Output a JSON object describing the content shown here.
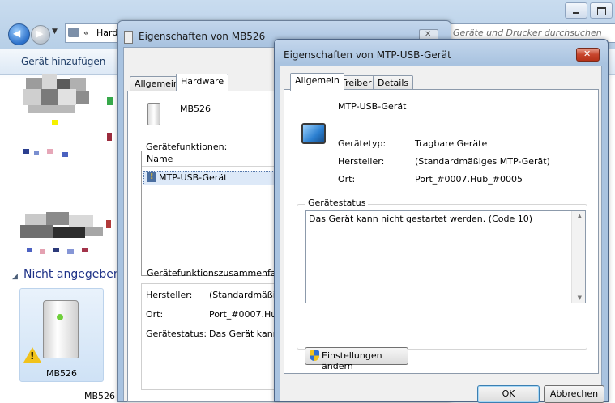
{
  "explorer": {
    "address_chevron": "«",
    "address_text": "Hard",
    "search_placeholder": "Geräte und Drucker durchsuchen",
    "toolbar_add_device": "Gerät hinzufügen",
    "group_label": "Nicht angegeben",
    "device_label": "MB526",
    "device_label_lower": "MB526"
  },
  "dialog1": {
    "title": "Eigenschaften von MB526",
    "tabs": [
      "Allgemein",
      "Hardware"
    ],
    "active_tab": "Hardware",
    "device_name": "MB526",
    "functions_label": "Gerätefunktionen:",
    "column_name": "Name",
    "function_row": "MTP-USB-Gerät",
    "summary_label": "Gerätefunktionszusammenfassung",
    "summary": [
      {
        "label": "Hersteller:",
        "value": "(Standardmäßiges"
      },
      {
        "label": "Ort:",
        "value": "Port_#0007.Hub_"
      },
      {
        "label": "Gerätestatus:",
        "value": "Das Gerät kann n"
      }
    ]
  },
  "dialog2": {
    "title": "Eigenschaften von MTP-USB-Gerät",
    "tabs": [
      "Allgemein",
      "Treiber",
      "Details"
    ],
    "active_tab": "Allgemein",
    "device_name": "MTP-USB-Gerät",
    "props": [
      {
        "label": "Gerätetyp:",
        "value": "Tragbare Geräte"
      },
      {
        "label": "Hersteller:",
        "value": "(Standardmäßiges MTP-Gerät)"
      },
      {
        "label": "Ort:",
        "value": "Port_#0007.Hub_#0005"
      }
    ],
    "status_group_label": "Gerätestatus",
    "status_text": "Das Gerät kann nicht gestartet werden. (Code 10)",
    "settings_button": "Einstellungen ändern",
    "ok_button": "OK",
    "cancel_button": "Abbrechen"
  }
}
